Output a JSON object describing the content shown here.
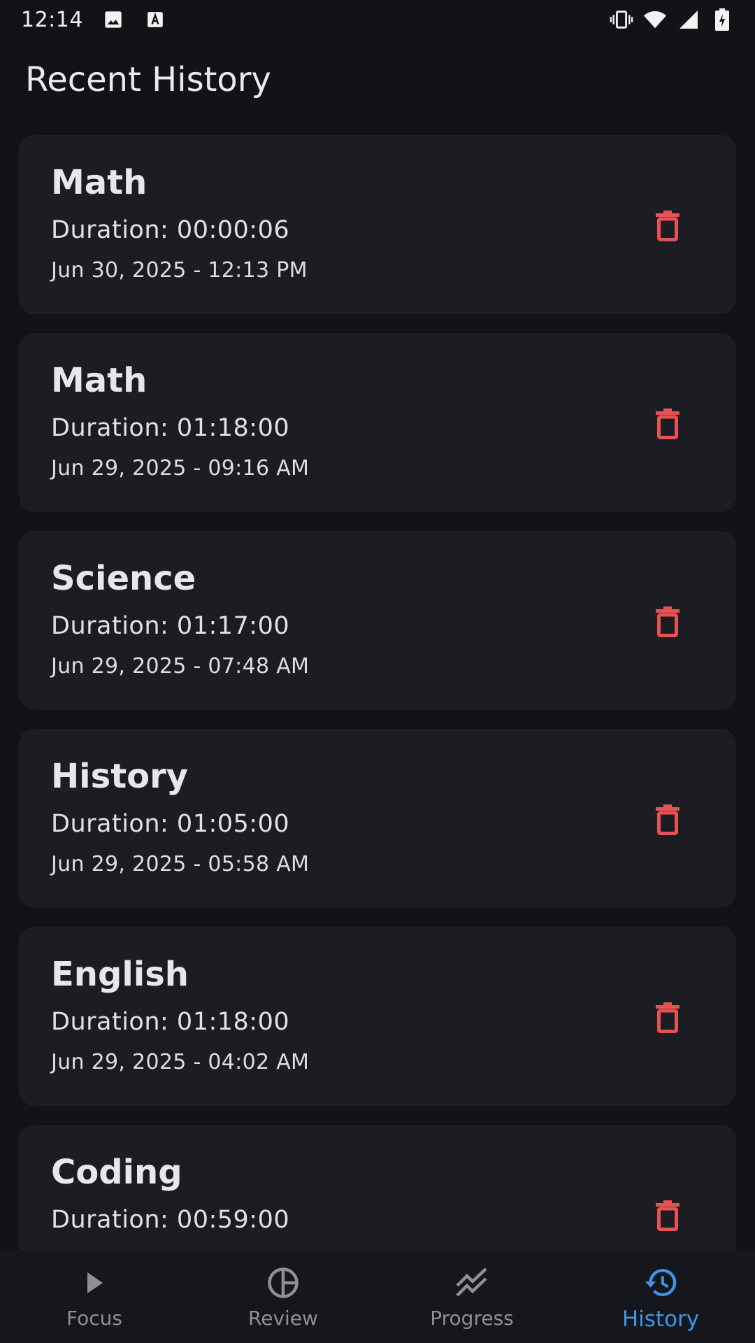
{
  "status_bar": {
    "time": "12:14",
    "left_icons": [
      "image-icon",
      "text-a-icon"
    ],
    "right_icons": [
      "vibrate-icon",
      "wifi-icon",
      "signal-icon",
      "battery-charging-icon"
    ]
  },
  "page": {
    "title": "Recent History"
  },
  "sessions": [
    {
      "subject": "Math",
      "duration": "Duration: 00:00:06",
      "date": "Jun 30, 2025 - 12:13 PM"
    },
    {
      "subject": "Math",
      "duration": "Duration: 01:18:00",
      "date": "Jun 29, 2025 - 09:16 AM"
    },
    {
      "subject": "Science",
      "duration": "Duration: 01:17:00",
      "date": "Jun 29, 2025 - 07:48 AM"
    },
    {
      "subject": "History",
      "duration": "Duration: 01:05:00",
      "date": "Jun 29, 2025 - 05:58 AM"
    },
    {
      "subject": "English",
      "duration": "Duration: 01:18:00",
      "date": "Jun 29, 2025 - 04:02 AM"
    },
    {
      "subject": "Coding",
      "duration": "Duration: 00:59:00",
      "date": ""
    }
  ],
  "delete_icon": "trash-icon",
  "bottom_nav": {
    "items": [
      {
        "label": "Focus",
        "icon": "play-icon",
        "active": false
      },
      {
        "label": "Review",
        "icon": "pie-chart-icon",
        "active": false
      },
      {
        "label": "Progress",
        "icon": "trending-icon",
        "active": false
      },
      {
        "label": "History",
        "icon": "history-icon",
        "active": true
      }
    ]
  },
  "colors": {
    "background": "#111317",
    "card": "#1b1d22",
    "delete": "#e85252",
    "active_nav": "#3f96e6",
    "inactive_nav": "#8d9096"
  }
}
